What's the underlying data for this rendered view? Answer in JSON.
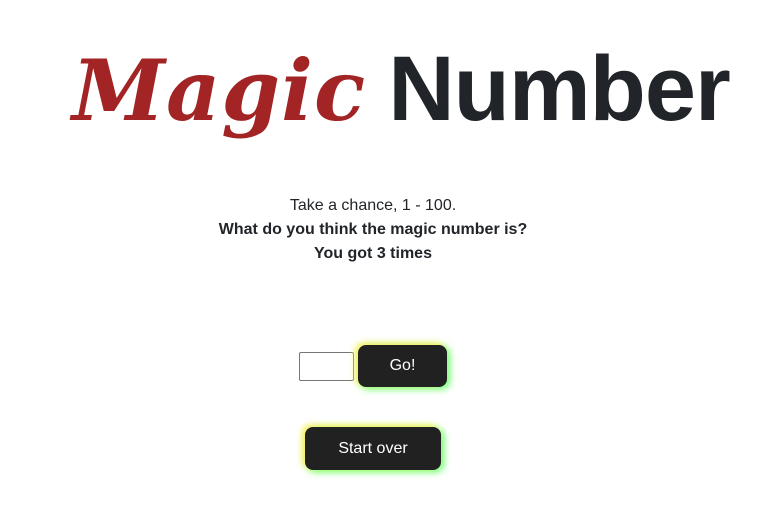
{
  "header": {
    "title_word1": "Magic",
    "title_word2": "Number",
    "title_word1_color": "#a32424",
    "title_word2_color": "#212529"
  },
  "intro": {
    "line1": "Take a chance, 1 - 100.",
    "line2": "What do you think the magic number is?",
    "line3": "You got 3 times"
  },
  "guess_form": {
    "input_value": "",
    "go_label": "Go!"
  },
  "controls": {
    "start_over_label": "Start over"
  },
  "colors": {
    "button_bg": "#212121",
    "glow_yellow": "#ffec50",
    "glow_green": "#5aff6e"
  }
}
